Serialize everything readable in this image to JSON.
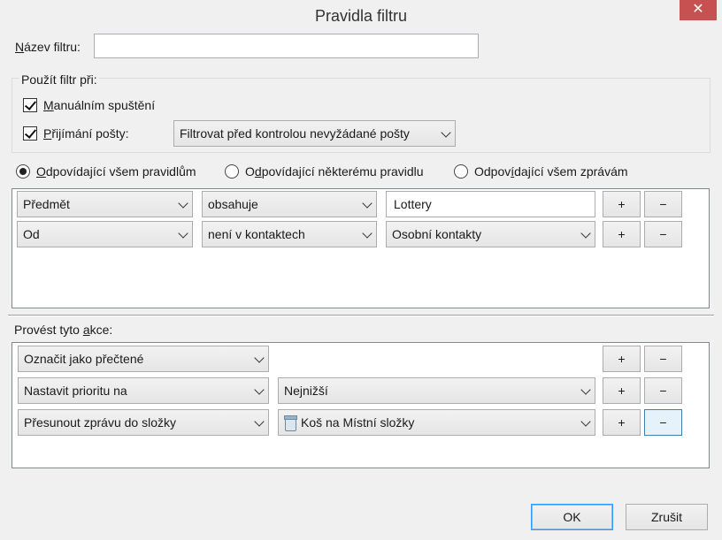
{
  "window": {
    "title": "Pravidla filtru",
    "close_glyph": "✕"
  },
  "filter_name": {
    "label_underlined": "N",
    "label_rest": "ázev filtru:",
    "value": ""
  },
  "apply_group": {
    "label": "Použít filtr při:",
    "manual": {
      "underlined": "M",
      "rest": "anuálním spuštění",
      "checked": true
    },
    "receiving": {
      "underlined": "P",
      "rest": "řijímání pošty:",
      "checked": true
    },
    "timing_select": "Filtrovat před kontrolou nevyžádané pošty"
  },
  "match": {
    "all_rules": {
      "underlined": "O",
      "rest": "dpovídající všem pravidlům",
      "selected": true
    },
    "any_rule": {
      "pre": "O",
      "underlined": "d",
      "rest": "povídající některému pravidlu",
      "selected": false
    },
    "all_messages": {
      "pre": "Odpov",
      "underlined": "í",
      "rest": "dající všem zprávám",
      "selected": false
    }
  },
  "rules": [
    {
      "field": "Předmět",
      "operator": "obsahuje",
      "value": "Lottery",
      "value_type": "text"
    },
    {
      "field": "Od",
      "operator": "není v kontaktech",
      "value": "Osobní kontakty",
      "value_type": "select"
    }
  ],
  "actions_label": {
    "pre": "Provést tyto ",
    "underlined": "a",
    "rest": "kce:"
  },
  "actions": [
    {
      "action": "Označit jako přečtené",
      "target": ""
    },
    {
      "action": "Nastavit prioritu na",
      "target": "Nejnižší"
    },
    {
      "action": "Přesunout zprávu do složky",
      "target": "Koš na Místní složky",
      "target_icon": "trash-icon"
    }
  ],
  "row_buttons": {
    "add": "+",
    "remove": "−"
  },
  "footer": {
    "ok": "OK",
    "cancel": "Zrušit"
  }
}
